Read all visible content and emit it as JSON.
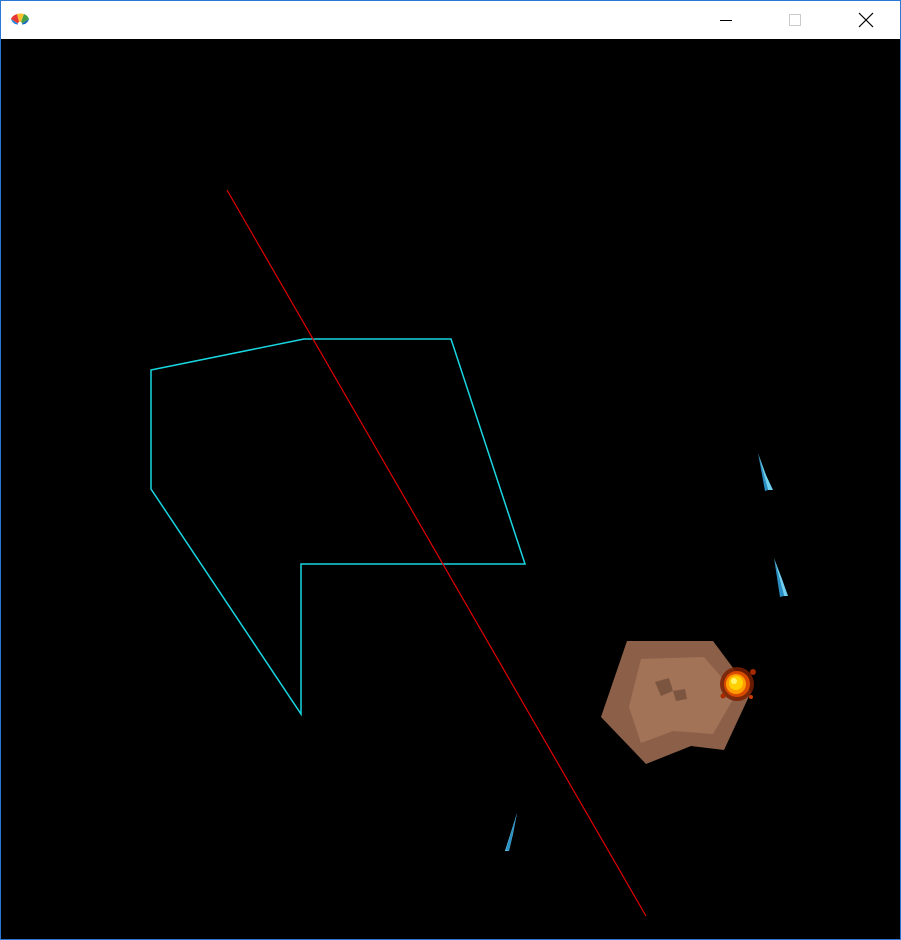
{
  "window": {
    "title": "",
    "icon": "color-wheel-icon",
    "controls": {
      "minimize_icon": "minimize-icon",
      "maximize_icon": "maximize-icon",
      "close_icon": "close-icon"
    }
  },
  "scene": {
    "background_color": "#000000",
    "outline_color": "#19d5e0",
    "laser_color": "#e00000",
    "asteroid_color": "#8c6048",
    "missile_color": "#6fd0f0",
    "explosion_color": "#ffcc00"
  }
}
